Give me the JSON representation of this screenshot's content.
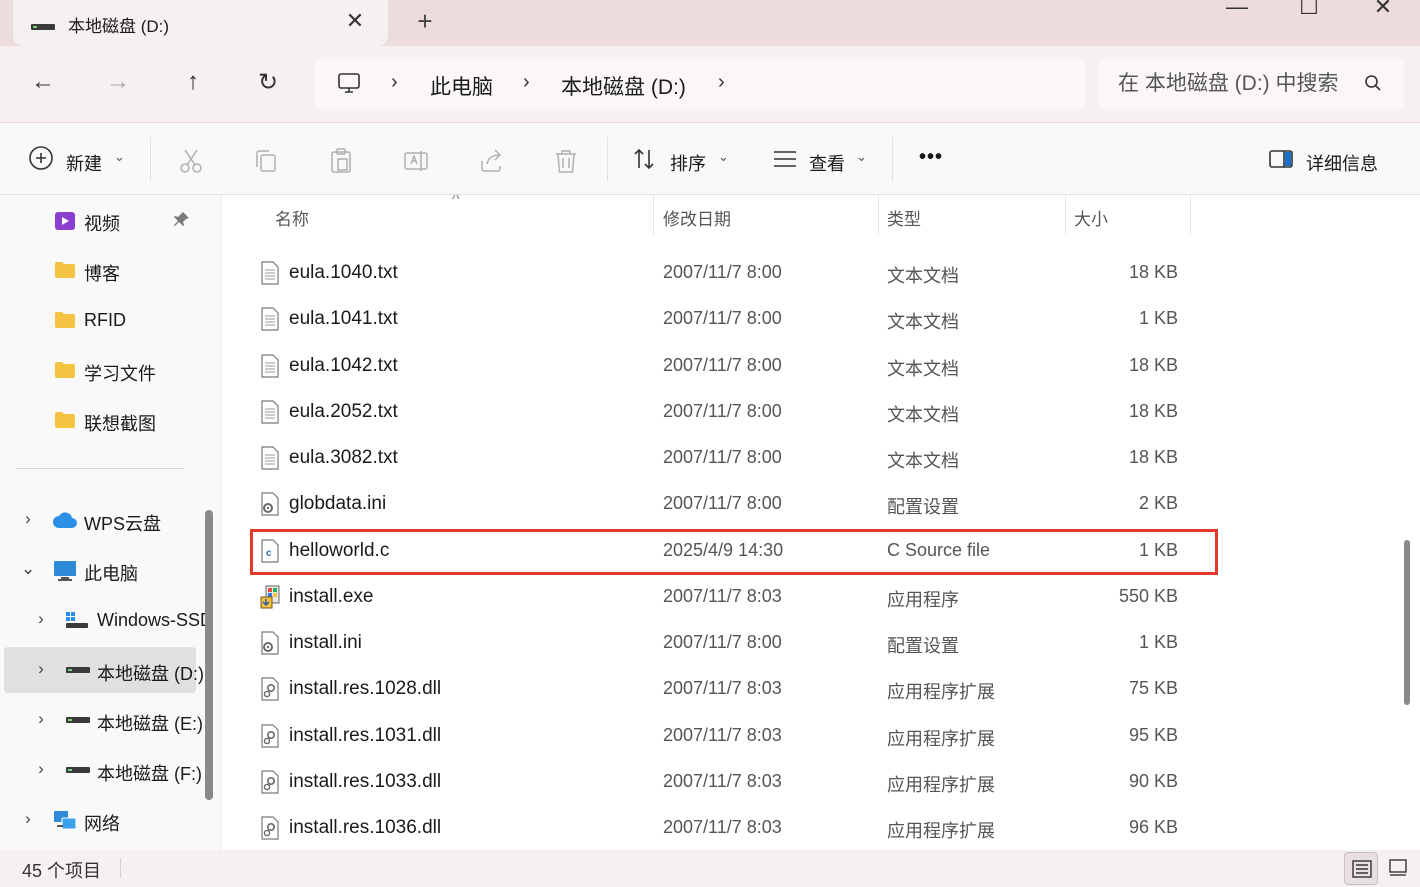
{
  "window": {
    "tab_title": "本地磁盘 (D:)",
    "tab_close": "✕",
    "new_tab": "+",
    "minimize": "—",
    "maximize": "☐",
    "close": "✕"
  },
  "nav": {
    "back": "←",
    "forward": "→",
    "up": "↑",
    "refresh": "↻"
  },
  "address": {
    "separator": "›",
    "crumbs": [
      "此电脑",
      "本地磁盘 (D:)"
    ]
  },
  "search": {
    "placeholder": "在 本地磁盘 (D:) 中搜索"
  },
  "toolbar": {
    "new_label": "新建",
    "sort_label": "排序",
    "view_label": "查看",
    "more": "•••",
    "details_label": "详细信息",
    "chevron": "⌄"
  },
  "sidebar": {
    "items": [
      {
        "label": "视频"
      },
      {
        "label": "博客"
      },
      {
        "label": "RFID"
      },
      {
        "label": "学习文件"
      },
      {
        "label": "联想截图"
      },
      {
        "label": "WPS云盘"
      },
      {
        "label": "此电脑"
      },
      {
        "label": "Windows-SSD"
      },
      {
        "label": "本地磁盘 (D:)"
      },
      {
        "label": "本地磁盘 (E:)"
      },
      {
        "label": "本地磁盘 (F:)"
      },
      {
        "label": "网络"
      }
    ],
    "expand_collapsed": "›",
    "expand_open": "⌄"
  },
  "table": {
    "headers": {
      "name": "名称",
      "modified": "修改日期",
      "type": "类型",
      "size": "大小"
    },
    "sort_indicator": "^",
    "rows": [
      {
        "name": "eula.1040.txt",
        "date": "2007/11/7 8:00",
        "type": "文本文档",
        "size": "18 KB",
        "icon": "text-file-icon"
      },
      {
        "name": "eula.1041.txt",
        "date": "2007/11/7 8:00",
        "type": "文本文档",
        "size": "1 KB",
        "icon": "text-file-icon"
      },
      {
        "name": "eula.1042.txt",
        "date": "2007/11/7 8:00",
        "type": "文本文档",
        "size": "18 KB",
        "icon": "text-file-icon"
      },
      {
        "name": "eula.2052.txt",
        "date": "2007/11/7 8:00",
        "type": "文本文档",
        "size": "18 KB",
        "icon": "text-file-icon"
      },
      {
        "name": "eula.3082.txt",
        "date": "2007/11/7 8:00",
        "type": "文本文档",
        "size": "18 KB",
        "icon": "text-file-icon"
      },
      {
        "name": "globdata.ini",
        "date": "2007/11/7 8:00",
        "type": "配置设置",
        "size": "2 KB",
        "icon": "settings-file-icon"
      },
      {
        "name": "helloworld.c",
        "date": "2025/4/9 14:30",
        "type": "C Source file",
        "size": "1 KB",
        "icon": "c-source-file-icon"
      },
      {
        "name": "install.exe",
        "date": "2007/11/7 8:03",
        "type": "应用程序",
        "size": "550 KB",
        "icon": "installer-app-icon"
      },
      {
        "name": "install.ini",
        "date": "2007/11/7 8:00",
        "type": "配置设置",
        "size": "1 KB",
        "icon": "settings-file-icon"
      },
      {
        "name": "install.res.1028.dll",
        "date": "2007/11/7 8:03",
        "type": "应用程序扩展",
        "size": "75 KB",
        "icon": "dll-file-icon"
      },
      {
        "name": "install.res.1031.dll",
        "date": "2007/11/7 8:03",
        "type": "应用程序扩展",
        "size": "95 KB",
        "icon": "dll-file-icon"
      },
      {
        "name": "install.res.1033.dll",
        "date": "2007/11/7 8:03",
        "type": "应用程序扩展",
        "size": "90 KB",
        "icon": "dll-file-icon"
      },
      {
        "name": "install.res.1036.dll",
        "date": "2007/11/7 8:03",
        "type": "应用程序扩展",
        "size": "96 KB",
        "icon": "dll-file-icon"
      }
    ]
  },
  "status": {
    "item_count": "45 个项目"
  },
  "colors": {
    "titlebar": "#ecdcdc",
    "highlight": "#e23a2c",
    "folder": "#f5c342",
    "accent": "#1a73c8"
  }
}
